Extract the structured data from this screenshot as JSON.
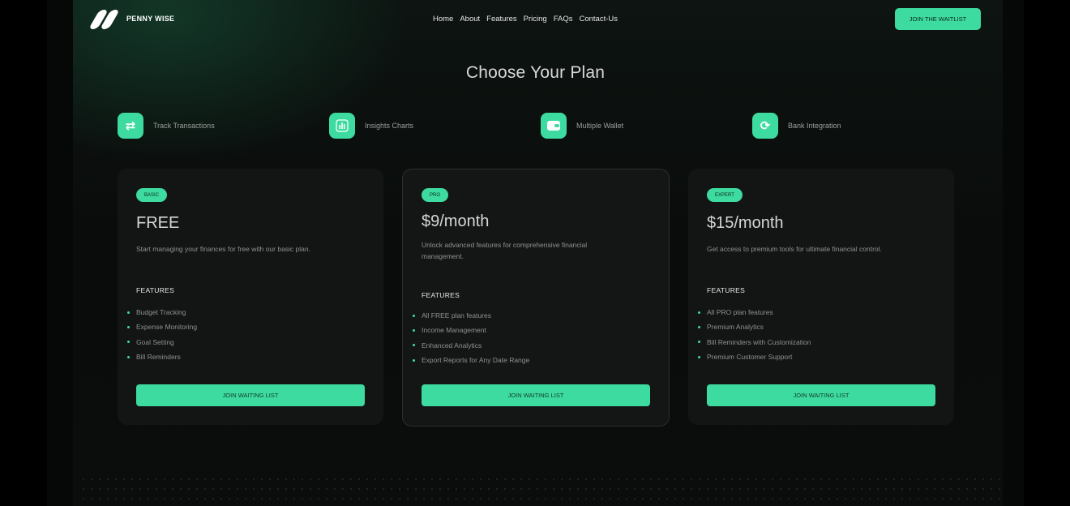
{
  "brand": {
    "name": "PENNY WISE"
  },
  "nav": {
    "items": [
      "Home",
      "About",
      "Features",
      "Pricing",
      "FAQs",
      "Contact-Us"
    ],
    "cta": "JOIN THE WAITLIST"
  },
  "hero": {
    "title": "Choose Your Plan"
  },
  "features": [
    {
      "icon": "arrows-exchange-icon",
      "label": "Track Transactions"
    },
    {
      "icon": "bar-chart-icon",
      "label": "Insights Charts"
    },
    {
      "icon": "wallet-icon",
      "label": "Multiple Wallet"
    },
    {
      "icon": "refresh-icon",
      "label": "Bank Integration"
    }
  ],
  "plans": [
    {
      "badge": "BASIC",
      "price": "FREE",
      "description": "Start managing your finances for free with our basic plan.",
      "features_heading": "FEATURES",
      "features": [
        "Budget Tracking",
        "Expense Monitoring",
        "Goal Setting",
        "Bill Reminders"
      ],
      "button": "JOIN WAITING LIST"
    },
    {
      "badge": "PRO",
      "price": "$9/month",
      "description": "Unlock advanced features for comprehensive financial management.",
      "features_heading": "FEATURES",
      "features": [
        "All FREE plan features",
        "Income Management",
        "Enhanced Analytics",
        "Export Reports for Any Date Range"
      ],
      "button": "JOIN WAITING LIST"
    },
    {
      "badge": "EXPERT",
      "price": "$15/month",
      "description": "Get access to premium tools for ultimate financial control.",
      "features_heading": "FEATURES",
      "features": [
        "All PRO plan features",
        "Premium Analytics",
        "Bill Reminders with Customization",
        "Premium Customer Support"
      ],
      "button": "JOIN WAITING LIST"
    }
  ],
  "colors": {
    "accent": "#3ddba0",
    "background": "#0b0c0c",
    "card": "#131515"
  }
}
